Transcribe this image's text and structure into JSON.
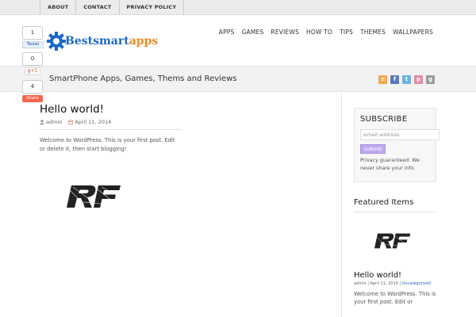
{
  "topnav": [
    "ABOUT",
    "CONTACT",
    "PRIVACY POLICY"
  ],
  "logo": {
    "part1": "Bestsmart",
    "part2": "apps"
  },
  "mainnav": [
    "APPS",
    "GAMES",
    "REVIEWS",
    "HOW TO",
    "TIPS",
    "THEMES",
    "WALLPAPERS"
  ],
  "share": {
    "tweet_count": "1",
    "tweet_label": "Tweet",
    "gplus_count": "0",
    "gplus_label": "g+1",
    "share_count": "4",
    "share_label": "Share"
  },
  "tagline": "SmartPhone Apps, Games, Thems and Reviews",
  "social": [
    {
      "icon": "rss-icon",
      "glyph": "≡",
      "color": "#f3a74a"
    },
    {
      "icon": "facebook-icon",
      "glyph": "f",
      "color": "#5b7bb8"
    },
    {
      "icon": "twitter-icon",
      "glyph": "t",
      "color": "#6cb3e6"
    },
    {
      "icon": "pinterest-icon",
      "glyph": "p",
      "color": "#e58aa0"
    },
    {
      "icon": "googleplus-icon",
      "glyph": "g",
      "color": "#9b9b9b"
    }
  ],
  "post": {
    "title": "Hello world!",
    "author": "admin",
    "date": "April 11, 2014",
    "excerpt": "Welcome to WordPress. This is your first post. Edit or delete it, then start blogging!"
  },
  "subscribe": {
    "title": "SUBSCRIBE",
    "email_placeholder": "email address",
    "button": "submit",
    "note": "Privacy guaranteed. We never share your info."
  },
  "featured": {
    "title": "Featured Items",
    "item_title": "Hello world!",
    "author": "admin",
    "date": "April 11, 2014",
    "category": "Uncategorized",
    "excerpt": "Welcome to WordPress. This is your first post. Edit or"
  },
  "colors": {
    "logo_blue": "#1b68c7",
    "logo_orange": "#f08a1c",
    "submit": "#c0a8f0",
    "share": "#f5654c"
  }
}
